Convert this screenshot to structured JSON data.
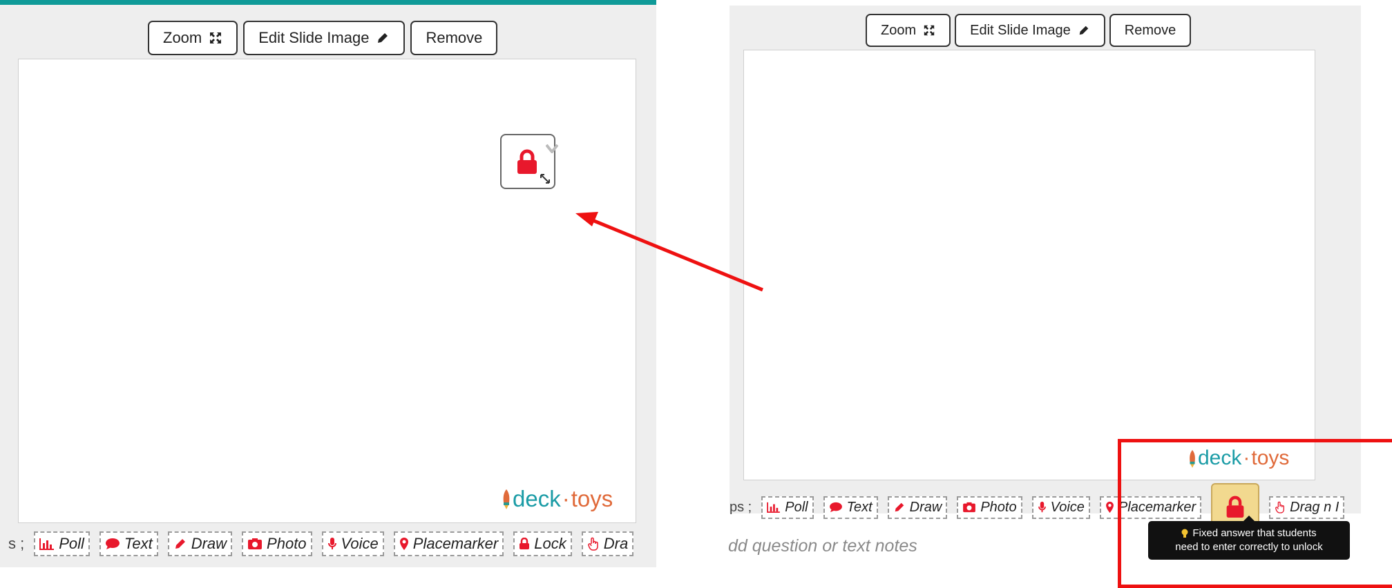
{
  "toolbar_top": {
    "zoom_label": "Zoom",
    "edit_label": "Edit Slide Image",
    "remove_label": "Remove"
  },
  "left": {
    "tools_lead": "s ;",
    "tools": [
      "Poll",
      "Text",
      "Draw",
      "Photo",
      "Voice",
      "Placemarker",
      "Lock",
      "Dra"
    ]
  },
  "right": {
    "tools_lead": "ps ;",
    "tools": [
      "Poll",
      "Text",
      "Draw",
      "Photo",
      "Voice",
      "Placemarker",
      "Drag n I"
    ],
    "notes_placeholder": "dd question or text notes",
    "tooltip_line1": "Fixed answer that students",
    "tooltip_line2": "need to enter correctly to unlock"
  },
  "brand": {
    "deck": "deck",
    "dot": "·",
    "toys": "toys"
  },
  "colors": {
    "accent_teal": "#0f9a98",
    "lock_red": "#e8182c",
    "annotation_red": "#ee1111",
    "lock_highlight": "#f2d98f"
  }
}
